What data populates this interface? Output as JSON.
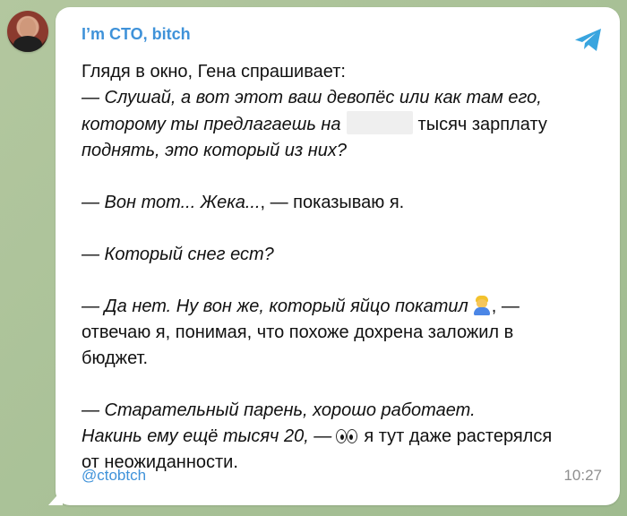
{
  "channel": {
    "title": "I’m CTO, bitch",
    "handle": "@ctobtch",
    "time": "10:27"
  },
  "post": {
    "line1": "Глядя в окно, Гена спрашивает:",
    "line2": "— Слушай, а вот этот ваш девопёс или как там его,",
    "line3_before": "которому ты предлагаешь на",
    "line3_after": "тысяч зарплату",
    "line4": "поднять, это который из них?",
    "line5_em": "— Вон тот... Жека...",
    "line5_plain": ", — показываю я.",
    "line6": "— Который снег ест?",
    "line7_em": "— Да нет. Ну вон же, который яйцо покатил",
    "line7_plain": ", —",
    "line8": "отвечаю я, понимая, что похоже дохрена заложил в",
    "line9": "бюджет.",
    "line10": "— Старательный парень, хорошо работает.",
    "line11_em": "Накинь ему ещё тысяч 20, —",
    "line11_plain": "я тут даже растерялся",
    "line12": "от неожиданности."
  },
  "icons": {
    "telegram": "telegram-icon",
    "person": "person-emoji-icon",
    "eyes": "eyes-emoji-icon"
  },
  "colors": {
    "accent": "#3f92d9",
    "background": "#a9c29a",
    "bubble": "#ffffff",
    "time": "#8f8f8f"
  }
}
